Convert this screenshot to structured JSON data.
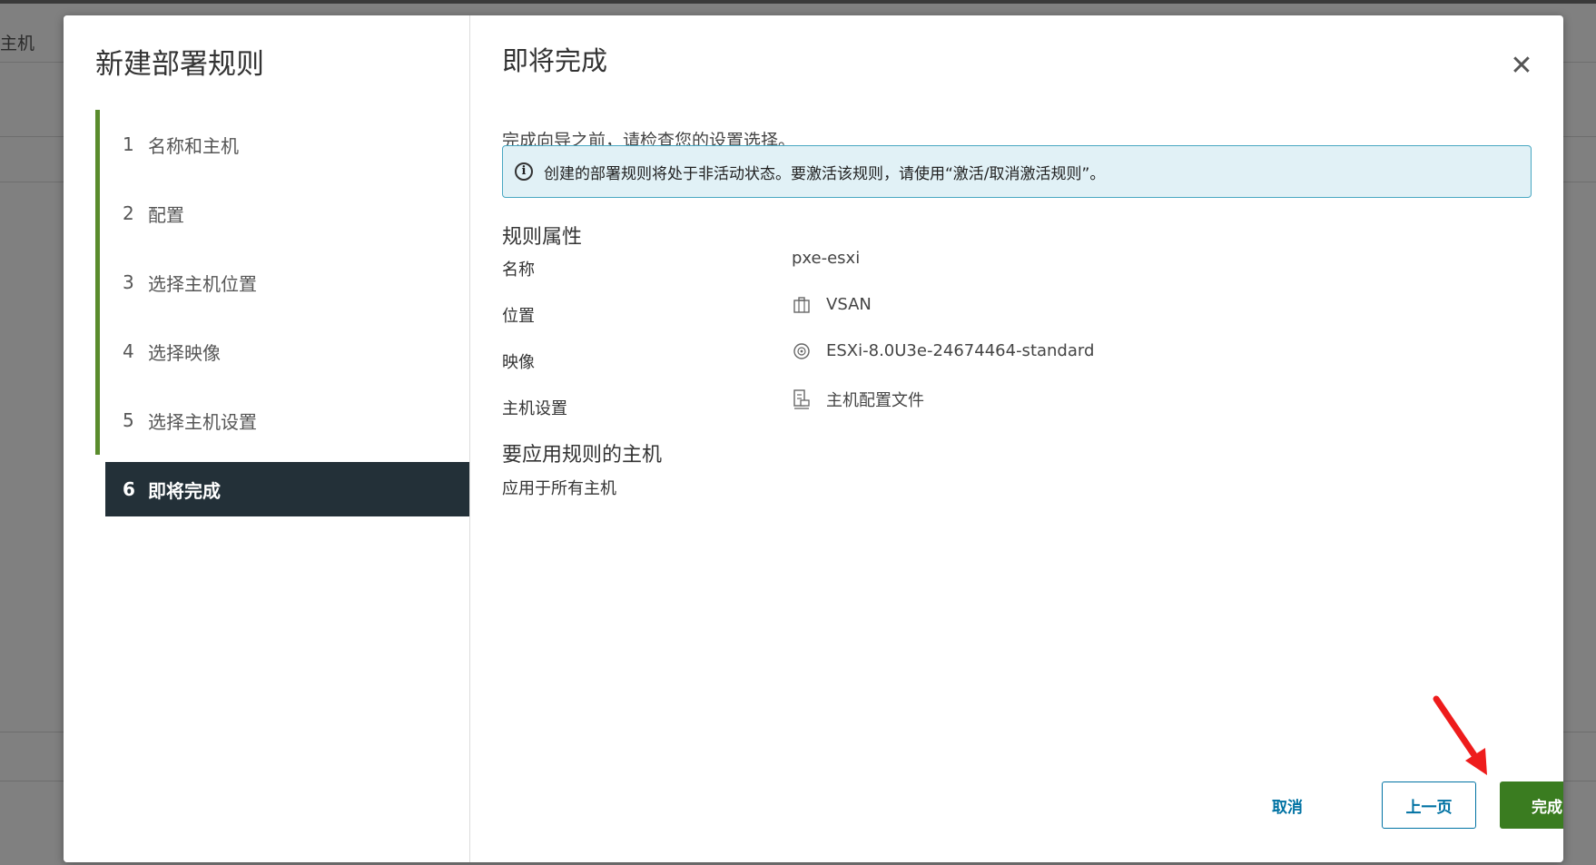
{
  "background": {
    "label": "主机"
  },
  "wizard": {
    "title": "新建部署规则",
    "steps": [
      {
        "num": "1",
        "label": "名称和主机"
      },
      {
        "num": "2",
        "label": "配置"
      },
      {
        "num": "3",
        "label": "选择主机位置"
      },
      {
        "num": "4",
        "label": "选择映像"
      },
      {
        "num": "5",
        "label": "选择主机设置"
      },
      {
        "num": "6",
        "label": "即将完成"
      }
    ]
  },
  "page": {
    "title": "即将完成",
    "intro": "完成向导之前，请检查您的设置选择。",
    "alert": "创建的部署规则将处于非活动状态。要激活该规则，请使用“激活/取消激活规则”。",
    "rule_section_title": "规则属性",
    "properties": [
      {
        "label": "名称",
        "value": "pxe-esxi",
        "icon": ""
      },
      {
        "label": "位置",
        "value": "VSAN",
        "icon": "datacenter-icon"
      },
      {
        "label": "映像",
        "value": "ESXi-8.0U3e-24674464-standard",
        "icon": "disc-icon"
      },
      {
        "label": "主机设置",
        "value": "主机配置文件",
        "icon": "host-profile-icon"
      }
    ],
    "hosts_section_title": "要应用规则的主机",
    "hosts_text": "应用于所有主机"
  },
  "buttons": {
    "cancel": "取消",
    "back": "上一页",
    "finish": "完成"
  },
  "colors": {
    "primary": "#0072a3",
    "finish": "#3a7c20",
    "step_done": "#5a8c2d",
    "active_step": "#233038"
  }
}
